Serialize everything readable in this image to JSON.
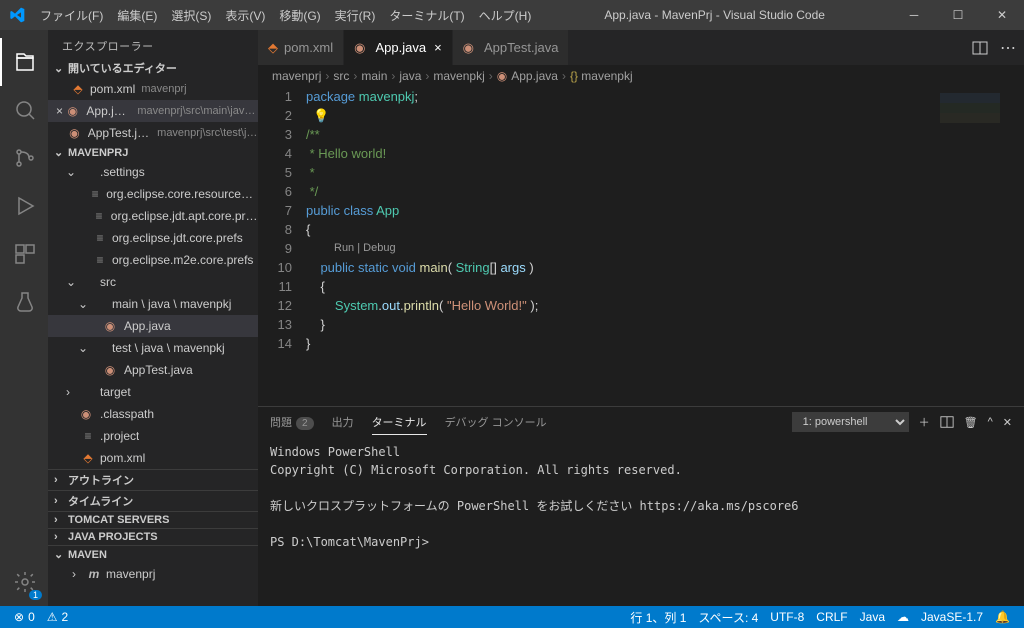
{
  "window": {
    "title": "App.java - MavenPrj - Visual Studio Code"
  },
  "menu": [
    "ファイル(F)",
    "編集(E)",
    "選択(S)",
    "表示(V)",
    "移動(G)",
    "実行(R)",
    "ターミナル(T)",
    "ヘルプ(H)"
  ],
  "sidebarTitle": "エクスプローラー",
  "openEditors": {
    "title": "開いているエディター",
    "items": [
      {
        "icon": "xml",
        "label": "pom.xml",
        "sub": "mavenprj"
      },
      {
        "icon": "java",
        "label": "App.java",
        "sub": "mavenprj\\src\\main\\java\\...",
        "active": true,
        "modified": true
      },
      {
        "icon": "java",
        "label": "AppTest.java",
        "sub": "mavenprj\\src\\test\\jav...",
        "modified": true
      }
    ]
  },
  "project": {
    "title": "MAVENPRJ",
    "tree": [
      {
        "d": 1,
        "twist": "v",
        "label": ".settings",
        "icon": "folder"
      },
      {
        "d": 2,
        "label": "org.eclipse.core.resources.prefs",
        "icon": "prefs"
      },
      {
        "d": 2,
        "label": "org.eclipse.jdt.apt.core.prefs",
        "icon": "prefs"
      },
      {
        "d": 2,
        "label": "org.eclipse.jdt.core.prefs",
        "icon": "prefs"
      },
      {
        "d": 2,
        "label": "org.eclipse.m2e.core.prefs",
        "icon": "prefs"
      },
      {
        "d": 1,
        "twist": "v",
        "label": "src",
        "icon": "folder"
      },
      {
        "d": 2,
        "twist": "v",
        "label": "main \\ java \\ mavenpkj",
        "icon": "folder"
      },
      {
        "d": 3,
        "label": "App.java",
        "icon": "java",
        "modified": true,
        "active": true
      },
      {
        "d": 2,
        "twist": "v",
        "label": "test \\ java \\ mavenpkj",
        "icon": "folder"
      },
      {
        "d": 3,
        "label": "AppTest.java",
        "icon": "java",
        "modified": true
      },
      {
        "d": 1,
        "twist": ">",
        "label": "target",
        "icon": "folder"
      },
      {
        "d": 1,
        "label": ".classpath",
        "icon": "java",
        "modified": true
      },
      {
        "d": 1,
        "label": ".project",
        "icon": "prefs"
      },
      {
        "d": 1,
        "label": "pom.xml",
        "icon": "xml"
      }
    ]
  },
  "collapsedSections": [
    "アウトライン",
    "タイムライン",
    "TOMCAT SERVERS",
    "JAVA PROJECTS"
  ],
  "maven": {
    "title": "MAVEN",
    "item": "mavenprj"
  },
  "tabs": [
    {
      "icon": "xml",
      "label": "pom.xml"
    },
    {
      "icon": "java",
      "label": "App.java",
      "active": true,
      "modified": true
    },
    {
      "icon": "java",
      "label": "AppTest.java",
      "modified": true
    }
  ],
  "breadcrumb": [
    "mavenprj",
    "src",
    "main",
    "java",
    "mavenpkj",
    "App.java",
    "{} mavenpkj"
  ],
  "code": {
    "lines": 14,
    "codelens": "Run | Debug",
    "content": [
      [
        {
          "c": "kw",
          "t": "package"
        },
        {
          "c": "pun",
          "t": " "
        },
        {
          "c": "pkg",
          "t": "mavenpkj"
        },
        {
          "c": "pun",
          "t": ";"
        }
      ],
      [
        {
          "c": "light",
          "t": "  💡"
        }
      ],
      [
        {
          "c": "cmt",
          "t": "/**"
        }
      ],
      [
        {
          "c": "cmt",
          "t": " * Hello world!"
        }
      ],
      [
        {
          "c": "cmt",
          "t": " *"
        }
      ],
      [
        {
          "c": "cmt",
          "t": " */"
        }
      ],
      [
        {
          "c": "kw",
          "t": "public"
        },
        {
          "c": "pun",
          "t": " "
        },
        {
          "c": "kw",
          "t": "class"
        },
        {
          "c": "pun",
          "t": " "
        },
        {
          "c": "cls",
          "t": "App"
        }
      ],
      [
        {
          "c": "pun",
          "t": "{"
        }
      ],
      [
        {
          "c": "pun",
          "t": "    "
        },
        {
          "c": "kw",
          "t": "public"
        },
        {
          "c": "pun",
          "t": " "
        },
        {
          "c": "kw",
          "t": "static"
        },
        {
          "c": "pun",
          "t": " "
        },
        {
          "c": "kw",
          "t": "void"
        },
        {
          "c": "pun",
          "t": " "
        },
        {
          "c": "fn",
          "t": "main"
        },
        {
          "c": "pun",
          "t": "( "
        },
        {
          "c": "cls",
          "t": "String"
        },
        {
          "c": "pun",
          "t": "[] "
        },
        {
          "c": "var",
          "t": "args"
        },
        {
          "c": "pun",
          "t": " )"
        }
      ],
      [
        {
          "c": "pun",
          "t": "    {"
        }
      ],
      [
        {
          "c": "pun",
          "t": "        "
        },
        {
          "c": "cls",
          "t": "System"
        },
        {
          "c": "pun",
          "t": "."
        },
        {
          "c": "var",
          "t": "out"
        },
        {
          "c": "pun",
          "t": "."
        },
        {
          "c": "fn",
          "t": "println"
        },
        {
          "c": "pun",
          "t": "( "
        },
        {
          "c": "str",
          "t": "\"Hello World!\""
        },
        {
          "c": "pun",
          "t": " );"
        }
      ],
      [
        {
          "c": "pun",
          "t": "    }"
        }
      ],
      [
        {
          "c": "pun",
          "t": "}"
        }
      ],
      []
    ]
  },
  "panel": {
    "tabs": [
      {
        "label": "問題",
        "badge": "2"
      },
      {
        "label": "出力"
      },
      {
        "label": "ターミナル",
        "active": true
      },
      {
        "label": "デバッグ コンソール"
      }
    ],
    "terminalSelect": "1: powershell",
    "terminal": "Windows PowerShell\nCopyright (C) Microsoft Corporation. All rights reserved.\n\n新しいクロスプラットフォームの PowerShell をお試しください https://aka.ms/pscore6\n\nPS D:\\Tomcat\\MavenPrj>"
  },
  "status": {
    "left": [
      {
        "icon": "⊗",
        "text": "0"
      },
      {
        "icon": "⚠",
        "text": "2"
      }
    ],
    "right": [
      "行 1、列 1",
      "スペース: 4",
      "UTF-8",
      "CRLF",
      "Java",
      "☁",
      "JavaSE-1.7",
      "🔔"
    ]
  }
}
